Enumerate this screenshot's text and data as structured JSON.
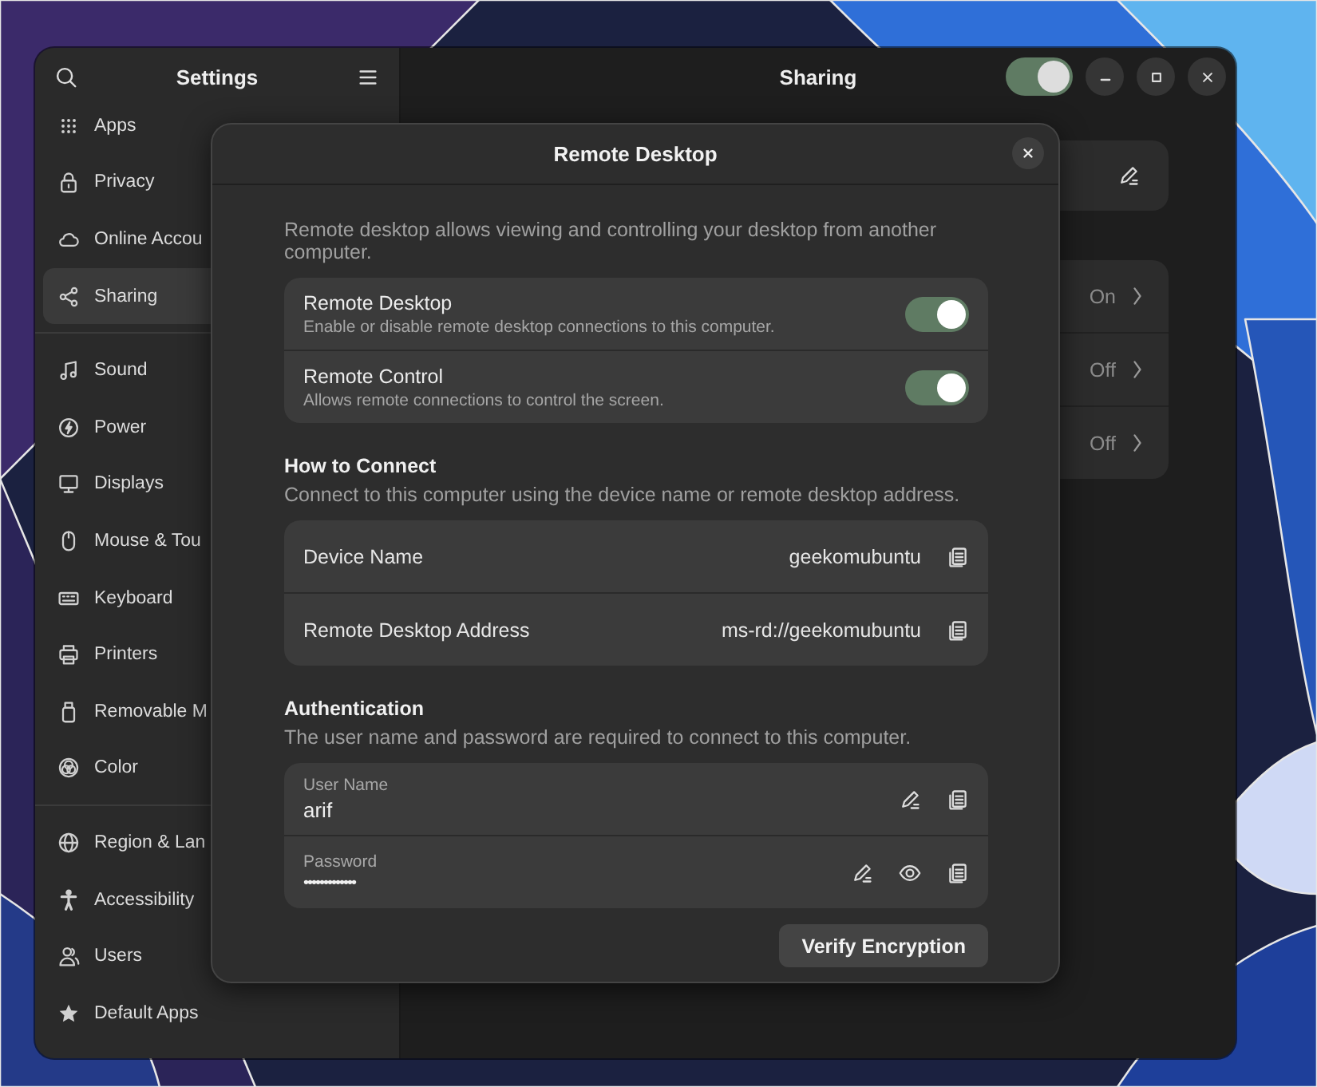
{
  "window": {
    "sidebar_title": "Settings",
    "title": "Sharing",
    "sharing_switch": {
      "on": true
    }
  },
  "sidebar": {
    "groups": [
      {
        "items": [
          {
            "label": "Apps",
            "selected": false
          },
          {
            "label": "Privacy",
            "selected": false
          },
          {
            "label": "Online Accou",
            "selected": false
          },
          {
            "label": "Sharing",
            "selected": true
          }
        ]
      },
      {
        "items": [
          {
            "label": "Sound",
            "selected": false
          },
          {
            "label": "Power",
            "selected": false
          },
          {
            "label": "Displays",
            "selected": false
          },
          {
            "label": "Mouse & Tou",
            "selected": false
          },
          {
            "label": "Keyboard",
            "selected": false
          },
          {
            "label": "Printers",
            "selected": false
          },
          {
            "label": "Removable M",
            "selected": false
          },
          {
            "label": "Color",
            "selected": false
          }
        ]
      },
      {
        "items": [
          {
            "label": "Region & Lan",
            "selected": false
          },
          {
            "label": "Accessibility",
            "selected": false
          },
          {
            "label": "Users",
            "selected": false
          },
          {
            "label": "Default Apps",
            "selected": false
          }
        ]
      }
    ]
  },
  "main": {
    "status_rows": [
      {
        "value": "On"
      },
      {
        "value": "Off"
      },
      {
        "value": "Off"
      }
    ]
  },
  "dialog": {
    "title": "Remote Desktop",
    "intro": "Remote desktop allows viewing and controlling your desktop from another computer.",
    "toggles": [
      {
        "title": "Remote Desktop",
        "subtitle": "Enable or disable remote desktop connections to this computer.",
        "on": true
      },
      {
        "title": "Remote Control",
        "subtitle": "Allows remote connections to control the screen.",
        "on": true
      }
    ],
    "connect": {
      "heading": "How to Connect",
      "description": "Connect to this computer using the device name or remote desktop address.",
      "rows": [
        {
          "label": "Device Name",
          "value": "geekomubuntu"
        },
        {
          "label": "Remote Desktop Address",
          "value": "ms-rd://geekomubuntu"
        }
      ]
    },
    "auth": {
      "heading": "Authentication",
      "description": "The user name and password are required to connect to this computer.",
      "fields": [
        {
          "kind": "text",
          "label": "User Name",
          "value": "arif"
        },
        {
          "kind": "password",
          "label": "Password",
          "value": "•••••••••••••"
        }
      ]
    },
    "button": "Verify Encryption"
  }
}
